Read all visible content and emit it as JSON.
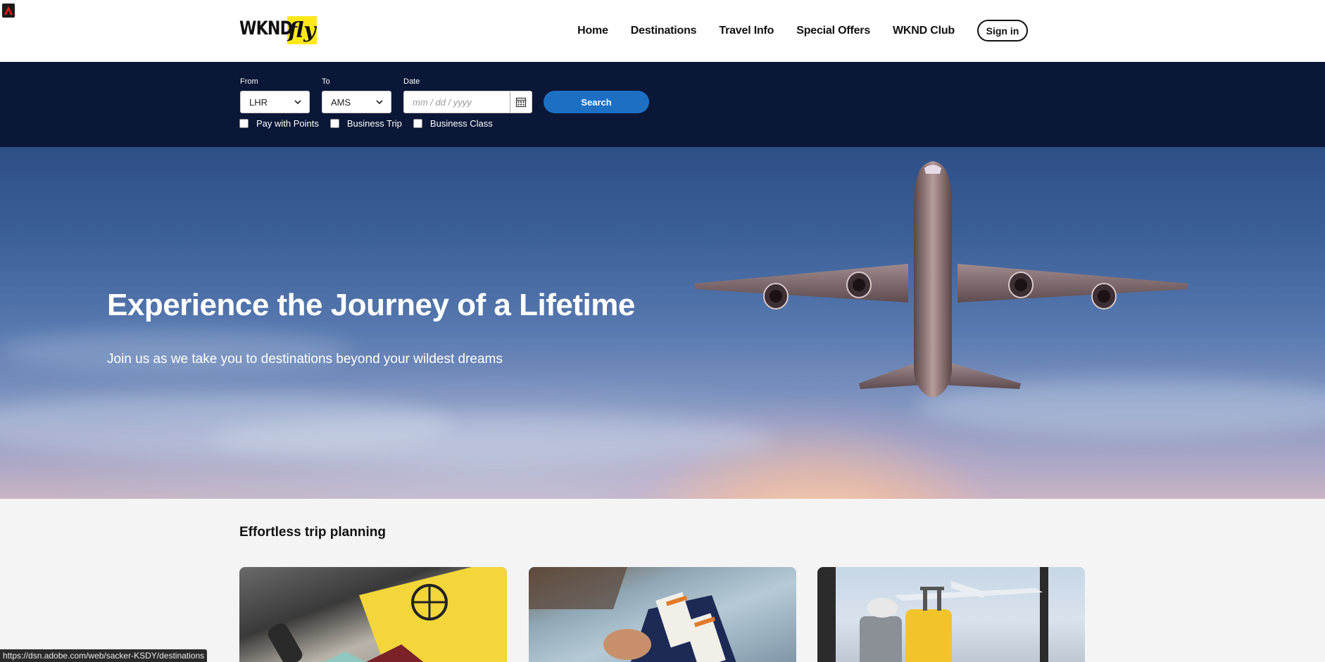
{
  "logo": {
    "wknd": "WKND",
    "fly": "fly"
  },
  "nav": {
    "items": [
      "Home",
      "Destinations",
      "Travel Info",
      "Special Offers",
      "WKND Club"
    ],
    "signin": "Sign in"
  },
  "search": {
    "from_label": "From",
    "from_value": "LHR",
    "to_label": "To",
    "to_value": "AMS",
    "date_label": "Date",
    "date_placeholder": "mm / dd / yyyy",
    "button": "Search",
    "options": [
      "Pay with Points",
      "Business Trip",
      "Business Class"
    ]
  },
  "hero": {
    "title": "Experience the Journey of a Lifetime",
    "subtitle": "Join us as we take you to destinations beyond your wildest dreams"
  },
  "section": {
    "title": "Effortless trip planning"
  },
  "status_url": "https://dsn.adobe.com/web/sacker-KSDY/destinations",
  "colors": {
    "band": "#0b1737",
    "search_button": "#1d6fc4",
    "logo_highlight": "#ffe81a"
  },
  "icons": [
    "adobe-icon",
    "chevron-down-icon",
    "calendar-icon"
  ]
}
